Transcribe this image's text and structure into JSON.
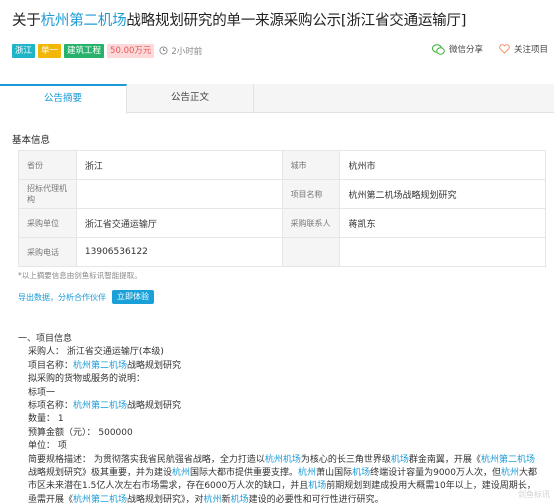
{
  "header": {
    "title_pre": "关于",
    "title_hl": "杭州第二机场",
    "title_post": "战略规划研究的单一来源采购公示[浙江省交通运输厅]"
  },
  "tags": {
    "region": "浙江",
    "type": "单一",
    "industry": "建筑工程",
    "amount": "50.00万元",
    "time": "2小时前",
    "colors": {
      "accent": "#1a9bd7",
      "region": "#1fb5c7",
      "type": "#f2b705",
      "industry": "#27b26b",
      "amount_bg": "#ffd9d9",
      "amount_fg": "#e5565a"
    }
  },
  "actions": {
    "share": "微信分享",
    "follow": "关注项目",
    "share_icon": "wechat-icon",
    "follow_icon": "heart-icon"
  },
  "tabs": {
    "summary": "公告摘要",
    "full_text": "公告正文"
  },
  "basic": {
    "title": "基本信息",
    "rows": [
      {
        "l1": "省份",
        "v1": "浙江",
        "l2": "城市",
        "v2": "杭州市"
      },
      {
        "l1": "招标代理机构",
        "v1": "",
        "l2": "项目名称",
        "v2": "杭州第二机场战略规划研究"
      },
      {
        "l1": "采购单位",
        "v1": "浙江省交通运输厅",
        "l2": "采购联系人",
        "v2": "蒋凯东"
      },
      {
        "l1": "采购电话",
        "v1": "13906536122",
        "l2": "",
        "v2": ""
      }
    ],
    "note": "*以上摘要信息由剑鱼标讯智能提取。",
    "export_link": "导出数据，分析合作伙伴",
    "trial_button": "立即体验"
  },
  "content": {
    "section": "一、项目信息",
    "buyer": "采购人： 浙江省交通运输厅(本级)",
    "name_pre": "项目名称：",
    "name_hl": "杭州第二机场",
    "name_post": "战略规划研究",
    "goods_desc": "拟采购的货物或服务的说明：",
    "lot": "标项一",
    "lot_name_pre": "标项名称：",
    "lot_name_hl": "杭州第二机场",
    "lot_name_post": "战略规划研究",
    "quantity": "数量： 1",
    "budget": "预算金额（元）： 500000",
    "unit": "单位： 项",
    "desc": [
      {
        "t": "简要规格描述： 为贯彻落实我省民航强省战略，全力打造以",
        "h": false
      },
      {
        "t": "杭州机场",
        "h": true
      },
      {
        "t": "为核心的长三角世界级",
        "h": false
      },
      {
        "t": "机场",
        "h": true
      },
      {
        "t": "群金南翼，开展《",
        "h": false
      },
      {
        "t": "杭州第二机场",
        "h": true
      },
      {
        "t": "战略规划研究》极其重要，并为建设",
        "h": false
      },
      {
        "t": "杭州",
        "h": true
      },
      {
        "t": "国际大都市提供重要支撑。",
        "h": false
      },
      {
        "t": "杭州",
        "h": true
      },
      {
        "t": "萧山国际",
        "h": false
      },
      {
        "t": "机场",
        "h": true
      },
      {
        "t": "终端设计容量为9000万人次，但",
        "h": false
      },
      {
        "t": "杭州",
        "h": true
      },
      {
        "t": "大都市区未来潜在1.5亿人次左右市场需求，存在6000万人次的缺口，并且",
        "h": false
      },
      {
        "t": "机场",
        "h": true
      },
      {
        "t": "前期规划到建成投用大概需10年以上，建设周期长，亟需开展《",
        "h": false
      },
      {
        "t": "杭州第二机场",
        "h": true
      },
      {
        "t": "战略规划研究》，对",
        "h": false
      },
      {
        "t": "杭州",
        "h": true
      },
      {
        "t": "新",
        "h": false
      },
      {
        "t": "机场",
        "h": true
      },
      {
        "t": "建设的必要性和可行性进行研究。",
        "h": false
      }
    ]
  },
  "watermark": "剑鱼标讯"
}
